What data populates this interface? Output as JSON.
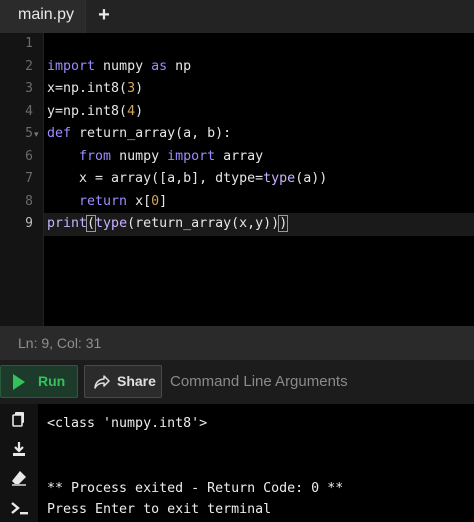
{
  "tabs": {
    "active_file": "main.py",
    "add_label": "+"
  },
  "editor": {
    "line_numbers": [
      "1",
      "2",
      "3",
      "4",
      "5",
      "6",
      "7",
      "8",
      "9"
    ],
    "active_line": 9,
    "code_lines": [
      "",
      "import numpy as np",
      "x=np.int8(3)",
      "y=np.int8(4)",
      "def return_array(a, b):",
      "    from numpy import array",
      "    x = array([a,b], dtype=type(a))",
      "    return x[0]",
      "print(type(return_array(x,y)))"
    ]
  },
  "status": {
    "position": "Ln: 9,  Col: 31"
  },
  "toolbar": {
    "run_label": "Run",
    "share_label": "Share",
    "args_placeholder": "Command Line Arguments"
  },
  "terminal": {
    "lines": [
      "<class 'numpy.int8'>",
      "",
      "",
      "** Process exited - Return Code: 0 **",
      "Press Enter to exit terminal"
    ]
  },
  "colors": {
    "run_green": "#35c25b",
    "keyword_purple": "#9c8cff",
    "number_orange": "#d4a65a",
    "editor_bg": "#000000"
  },
  "icons": [
    "copy-icon",
    "download-icon",
    "eraser-icon",
    "terminal-prompt-icon",
    "play-icon",
    "share-icon"
  ]
}
